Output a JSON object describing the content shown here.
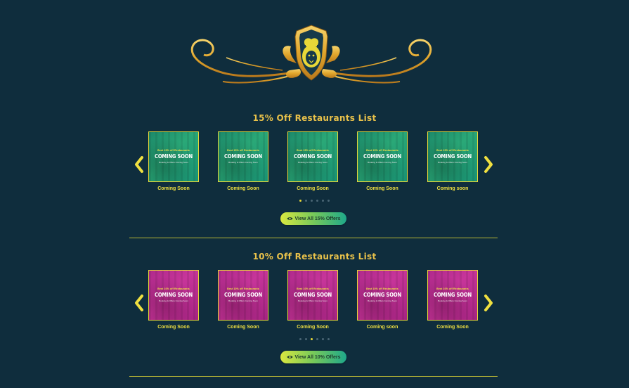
{
  "colors": {
    "background": "#0f2d3d",
    "gold": "#e8c14a",
    "card_border": "#e8d838",
    "green_card": "#2aa877",
    "pink_card": "#c7359a"
  },
  "crest": {
    "icon": "lion-chef-crest-icon"
  },
  "sections": [
    {
      "title": "15% Off Restaurants List",
      "theme": "green",
      "cards": [
        {
          "top_text": "Best 15% off Restaurants",
          "big_text": "COMING SOON",
          "sub_text": "Booking & Offers Coming Soon",
          "label": "Coming Soon"
        },
        {
          "top_text": "Best 15% off Restaurants",
          "big_text": "COMING SOON",
          "sub_text": "Booking & Offers Coming Soon",
          "label": "Coming Soon"
        },
        {
          "top_text": "Best 15% off Restaurants",
          "big_text": "COMING SOON",
          "sub_text": "Booking & Offers Coming Soon",
          "label": "Coming Soon"
        },
        {
          "top_text": "Best 15% off Restaurants",
          "big_text": "COMING SOON",
          "sub_text": "Booking & Offers Coming Soon",
          "label": "Coming Soon"
        },
        {
          "top_text": "Best 15% off Restaurants",
          "big_text": "COMING SOON",
          "sub_text": "Booking & Offers Coming Soon",
          "label": "Coming soon"
        }
      ],
      "pagination": {
        "count": 6,
        "active": 0
      },
      "button_label": "View All 15% Offers"
    },
    {
      "title": "10% Off Restaurants List",
      "theme": "pink",
      "cards": [
        {
          "top_text": "Best 10% off Restaurants",
          "big_text": "COMING SOON",
          "sub_text": "Booking & Offers Coming Soon",
          "label": "Coming Soon"
        },
        {
          "top_text": "Best 10% off Restaurants",
          "big_text": "COMING SOON",
          "sub_text": "Booking & Offers Coming Soon",
          "label": "Coming Soon"
        },
        {
          "top_text": "Best 10% off Restaurants",
          "big_text": "COMING SOON",
          "sub_text": "Booking & Offers Coming Soon",
          "label": "Coming Soon"
        },
        {
          "top_text": "Best 10% off Restaurants",
          "big_text": "COMING SOON",
          "sub_text": "Booking & Offers Coming Soon",
          "label": "Coming soon"
        },
        {
          "top_text": "Best 10% off Restaurants",
          "big_text": "COMING SOON",
          "sub_text": "Booking & Offers Coming Soon",
          "label": "Coming Soon"
        }
      ],
      "pagination": {
        "count": 6,
        "active": 2
      },
      "button_label": "View All 10% Offers"
    }
  ]
}
